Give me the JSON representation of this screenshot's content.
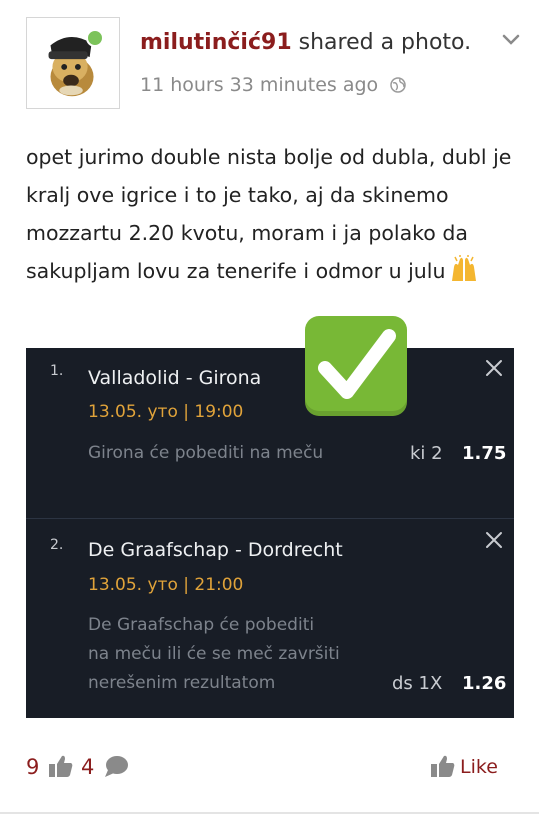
{
  "post": {
    "author": "milutinčić91",
    "action": " shared a photo.",
    "time": "11 hours 33 minutes ago",
    "text": "opet jurimo double nista bolje od dubla, dubl je kralj ove igrice i to je tako, aj da skinemo mozzartu 2.20 kvotu, moram i ja polako da sakupljam lovu za tenerife i odmor u julu",
    "text_emoji_icon": "raising-hands-icon",
    "avatar_online_color": "#7cc35a",
    "accent_color": "#8b1d1d"
  },
  "ticket": {
    "badge_icon": "check-mark-button-icon",
    "selections": [
      {
        "num": "1.",
        "match": "Valladolid - Girona",
        "datetime": "13.05. уто | 19:00",
        "pick_lines": [
          "Girona  će pobediti na meču"
        ],
        "code": "ki 2",
        "odds": "1.75"
      },
      {
        "num": "2.",
        "match": "De Graafschap - Dordrecht",
        "datetime": "13.05. уто | 21:00",
        "pick_lines": [
          "De Graafschap će pobediti",
          "na meču ili će se meč završiti",
          "nerešenim rezultatom"
        ],
        "code": "ds 1X",
        "odds": "1.26"
      }
    ]
  },
  "footer": {
    "likes": "9",
    "comments": "4",
    "like_label": "Like"
  }
}
